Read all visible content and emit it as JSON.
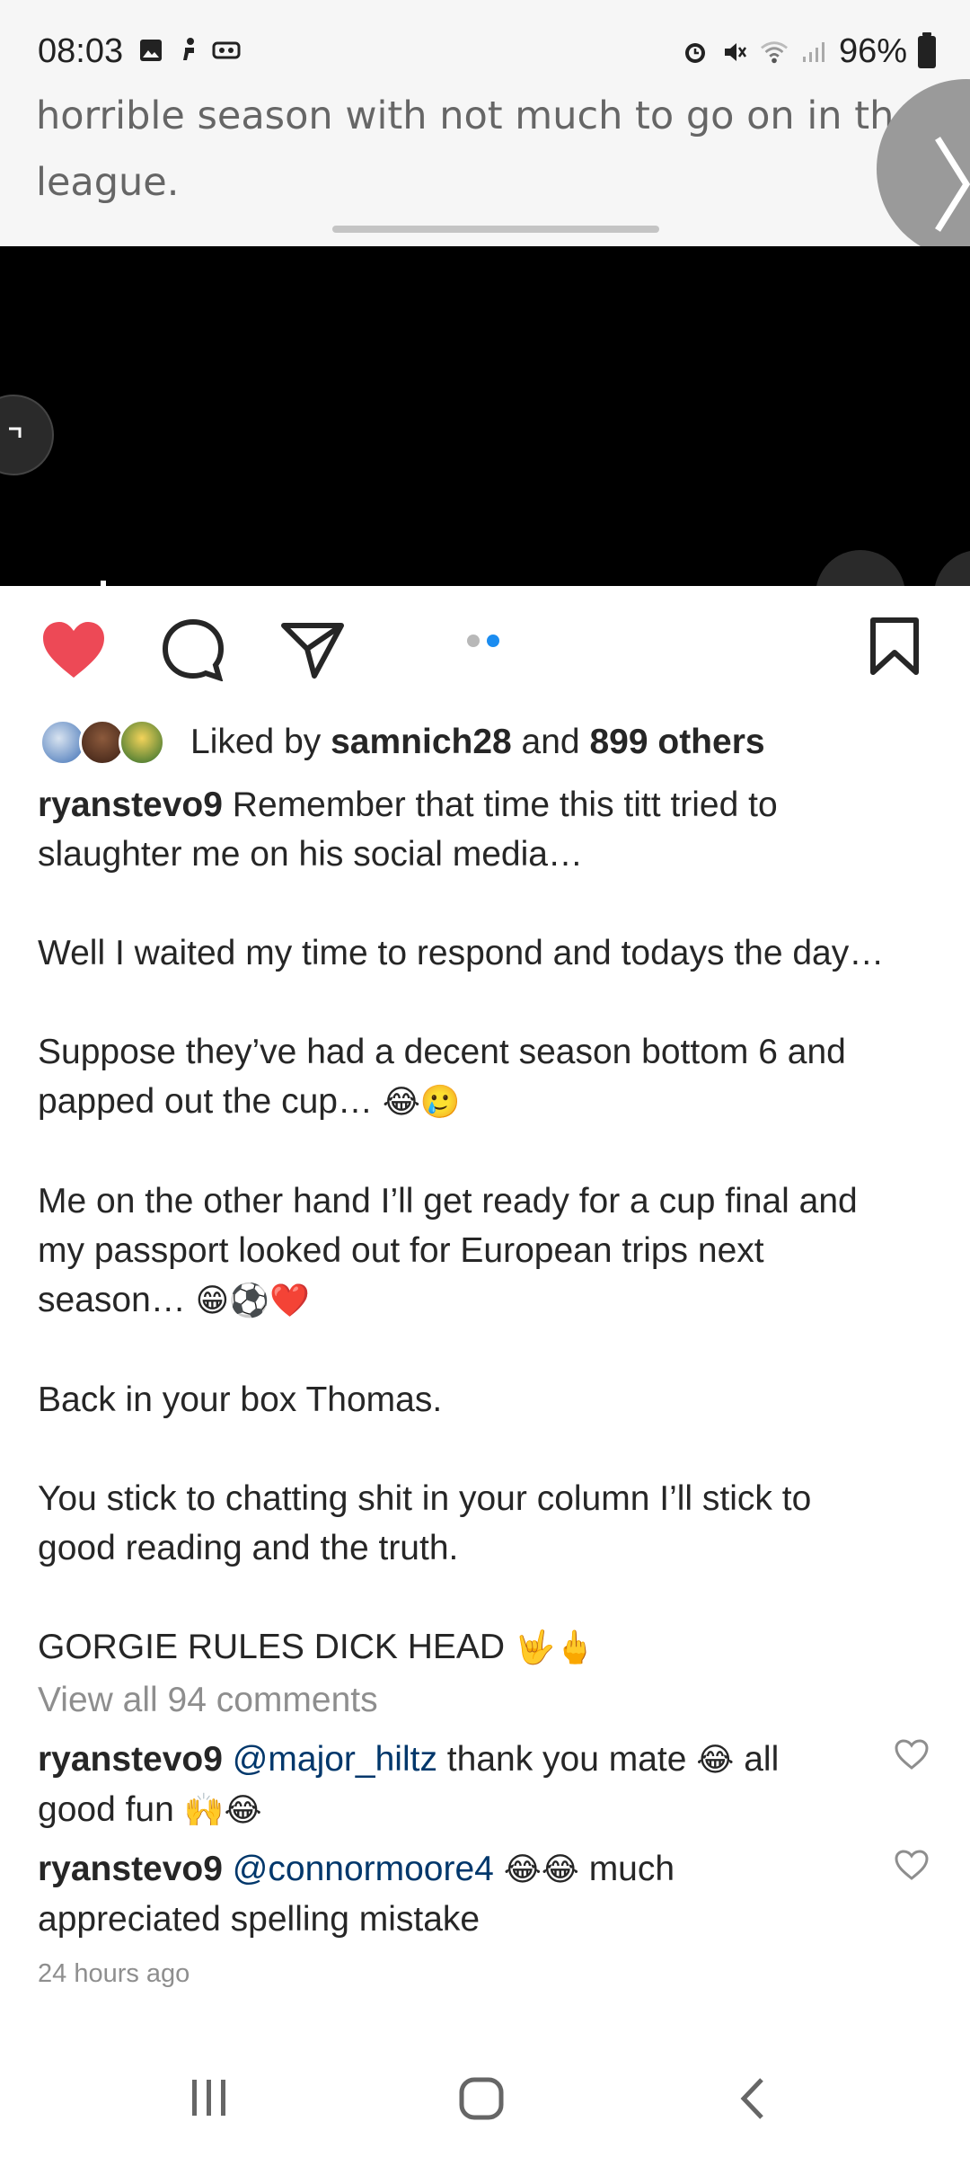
{
  "status_bar": {
    "time": "08:03",
    "battery": "96%",
    "left_icons": [
      "gallery-icon",
      "accessibility-icon",
      "vr-icon"
    ],
    "right_icons": [
      "alarm-icon",
      "mute-icon",
      "wifi-icon",
      "signal-icon",
      "battery-icon"
    ]
  },
  "article_preview": {
    "lines": [
      "horrible season with not much to go on in the",
      "league."
    ]
  },
  "post": {
    "likes": {
      "prefix": "Liked by ",
      "user": "samnich28",
      "middle": " and ",
      "count_text": "899 others"
    },
    "caption": {
      "username": "ryanstevo9",
      "lines": [
        " Remember that time this titt tried to",
        "slaughter me on his social media…",
        "",
        "Well I waited my time to respond and todays the day…",
        "",
        "Suppose they’ve had a decent season bottom 6 and",
        "papped out the cup…",
        "",
        "Me on the other hand I’ll get ready for a cup final and",
        "my passport looked out for European trips next",
        "season…",
        "",
        "Back in your box Thomas.",
        "",
        "You stick to chatting shit in your column I’ll stick to",
        "good reading and the truth.",
        "",
        "GORGIE RULES DICK HEAD"
      ],
      "emoji_line6": "😂🥲",
      "emoji_line10": "😁⚽❤️",
      "emoji_line17": "🤟🖕"
    },
    "view_all_comments": "View all 94 comments",
    "comments": [
      {
        "username": "ryanstevo9",
        "mention": "@major_hiltz",
        "text1": " thank you mate ",
        "emoji1": "😂",
        "text2": " all",
        "line2": "good fun ",
        "emoji2": "🙌😂"
      },
      {
        "username": "ryanstevo9",
        "mention": "@connormoore4",
        "text1": " ",
        "emoji1": "😂😂",
        "text2": " much",
        "line2": "appreciated spelling mistake"
      }
    ],
    "timestamp": "24 hours ago"
  },
  "colors": {
    "like_red": "#ed4956",
    "carousel_active": "#1b8cf0",
    "mention_blue": "#00376b",
    "muted_gray": "#8e8e8e"
  }
}
